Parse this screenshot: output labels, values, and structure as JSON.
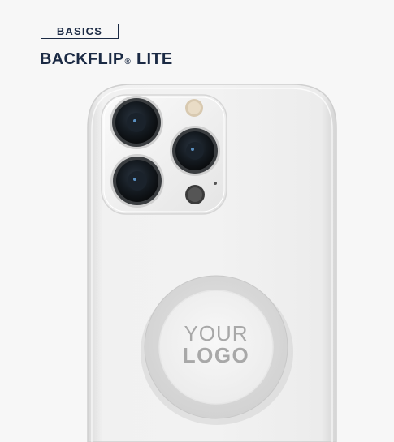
{
  "header": {
    "badge": "BASICS",
    "title_main": "BACKFLIP",
    "title_mark": "®",
    "title_rest": " LITE"
  },
  "grip": {
    "line1": "YOUR",
    "line2": "LOGO"
  },
  "colors": {
    "brand_navy": "#1b2a44",
    "phone_body": "#eeeeee",
    "grip_ring": "#dcdcdc",
    "logo_text": "#a8a8a8"
  }
}
